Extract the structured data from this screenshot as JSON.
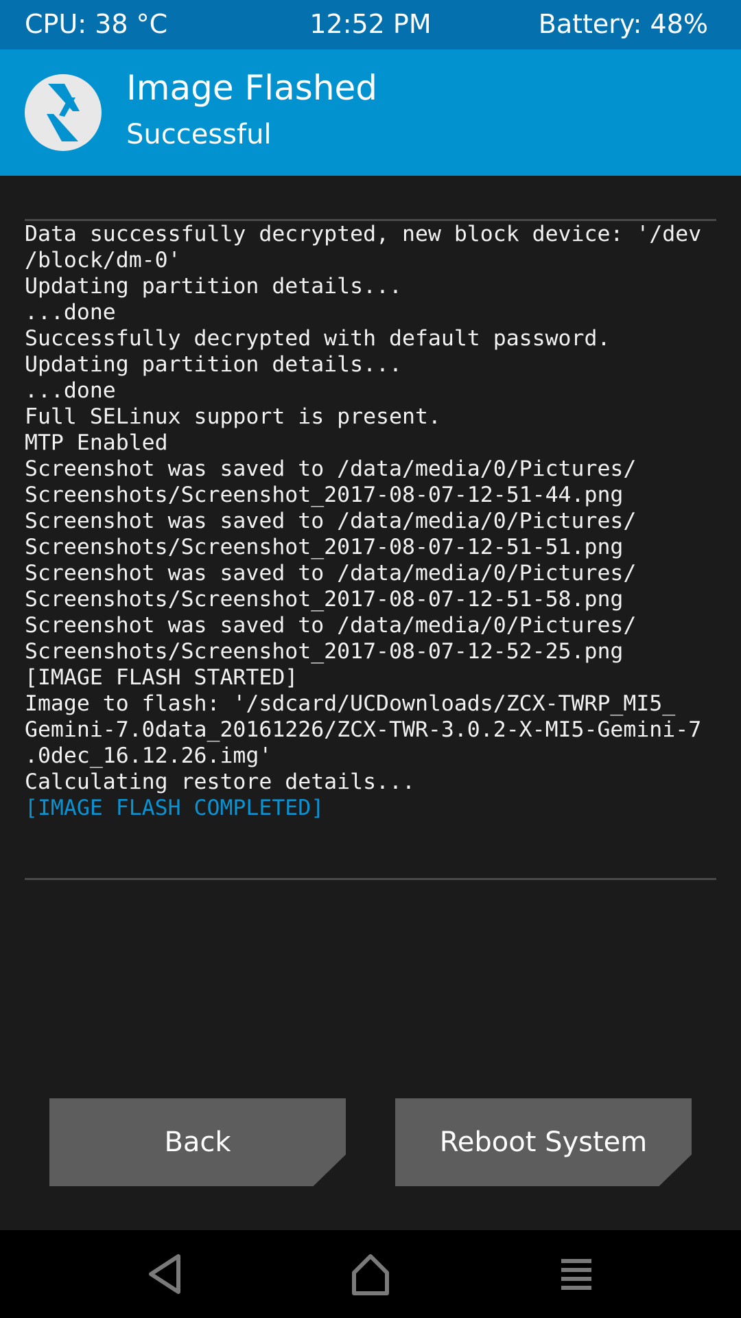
{
  "status_bar": {
    "cpu": "CPU: 38 °C",
    "time": "12:52 PM",
    "battery": "Battery: 48%"
  },
  "header": {
    "logo_icon": "twrp-logo-icon",
    "title": "Image Flashed",
    "subtitle": "Successful"
  },
  "console": {
    "lines": [
      "Data successfully decrypted, new block device: '/dev",
      "/block/dm-0'",
      "Updating partition details...",
      "...done",
      "Successfully decrypted with default password.",
      "Updating partition details...",
      "...done",
      "Full SELinux support is present.",
      "MTP Enabled",
      "Screenshot was saved to /data/media/0/Pictures/",
      "Screenshots/Screenshot_2017-08-07-12-51-44.png",
      "Screenshot was saved to /data/media/0/Pictures/",
      "Screenshots/Screenshot_2017-08-07-12-51-51.png",
      "Screenshot was saved to /data/media/0/Pictures/",
      "Screenshots/Screenshot_2017-08-07-12-51-58.png",
      "Screenshot was saved to /data/media/0/Pictures/",
      "Screenshots/Screenshot_2017-08-07-12-52-25.png",
      "[IMAGE FLASH STARTED]",
      "Image to flash: '/sdcard/UCDownloads/ZCX-TWRP_MI5_",
      "Gemini-7.0data_20161226/ZCX-TWR-3.0.2-X-MI5-Gemini-7",
      ".0dec_16.12.26.img'",
      "Calculating restore details...",
      "[IMAGE FLASH COMPLETED]"
    ]
  },
  "buttons": {
    "back": "Back",
    "reboot": "Reboot System"
  },
  "nav": {
    "back_icon": "back-triangle-icon",
    "home_icon": "home-icon",
    "menu_icon": "menu-icon"
  },
  "colors": {
    "status_bar": "#0470ad",
    "header": "#0292d0",
    "background": "#1b1b1b",
    "console_text": "#f2f2f2",
    "console_highlight": "#0a93d3",
    "button": "#5d5d5d"
  }
}
